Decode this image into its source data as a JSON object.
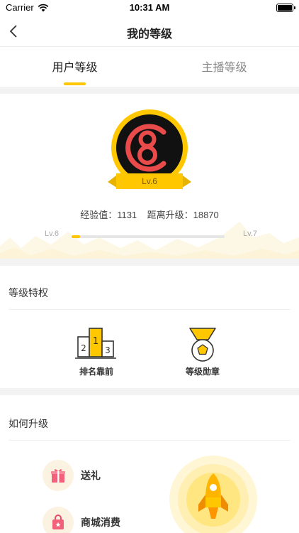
{
  "status_bar": {
    "carrier": "Carrier",
    "time": "10:31 AM"
  },
  "nav": {
    "title": "我的等级"
  },
  "tabs": [
    {
      "label": "用户等级",
      "active": true
    },
    {
      "label": "主播等级",
      "active": false
    }
  ],
  "level": {
    "badge_number": "8",
    "badge_label": "Lv.6",
    "exp_label": "经验值：",
    "exp_value": "1131",
    "to_next_label": "距离升级：",
    "to_next_value": "18870",
    "current_level": "Lv.6",
    "next_level": "Lv.7",
    "progress_fraction": 0.057
  },
  "privileges": {
    "title": "等级特权",
    "items": [
      {
        "label": "排名靠前",
        "icon": "podium-icon"
      },
      {
        "label": "等级勋章",
        "icon": "medal-icon"
      }
    ]
  },
  "upgrade": {
    "title": "如何升级",
    "items": [
      {
        "label": "送礼",
        "icon": "gift-icon"
      },
      {
        "label": "商城消费",
        "icon": "shopping-bag-icon"
      }
    ]
  },
  "colors": {
    "accent": "#FFC700",
    "badge_red": "#E94B4B",
    "badge_dark": "#111111"
  }
}
